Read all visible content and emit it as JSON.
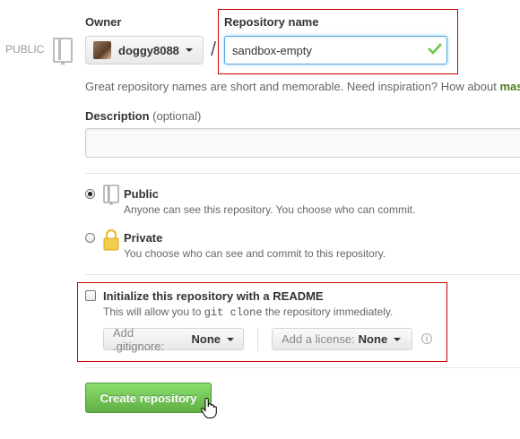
{
  "side": {
    "public_label": "PUBLIC"
  },
  "owner": {
    "label": "Owner",
    "name": "doggy8088"
  },
  "slash": "/",
  "repo": {
    "label": "Repository name",
    "value": "sandbox-empty"
  },
  "hint": {
    "text": "Great repository names are short and memorable. Need inspiration? How about ",
    "suggestion": "mas"
  },
  "description": {
    "label": "Description",
    "optional": "(optional)",
    "value": ""
  },
  "visibility": {
    "public": {
      "title": "Public",
      "desc": "Anyone can see this repository. You choose who can commit.",
      "selected": true
    },
    "private": {
      "title": "Private",
      "desc": "You choose who can see and commit to this repository.",
      "selected": false
    }
  },
  "init": {
    "title": "Initialize this repository with a README",
    "desc_before": "This will allow you to ",
    "desc_code": "git clone",
    "desc_after": " the repository immediately.",
    "checked": false
  },
  "gitignore": {
    "label": "Add .gitignore:",
    "value": "None"
  },
  "license": {
    "label": "Add a license:",
    "value": "None"
  },
  "info_glyph": "i",
  "submit": {
    "label": "Create repository"
  },
  "colors": {
    "accent_blue": "#51a7e8",
    "create_green": "#60b044",
    "highlight_red": "#cc0000",
    "suggestion_green": "#4a7f1e"
  },
  "icons": [
    "book-icon",
    "chevron-down-icon",
    "check-icon",
    "lock-icon",
    "info-icon",
    "hand-cursor-icon"
  ]
}
